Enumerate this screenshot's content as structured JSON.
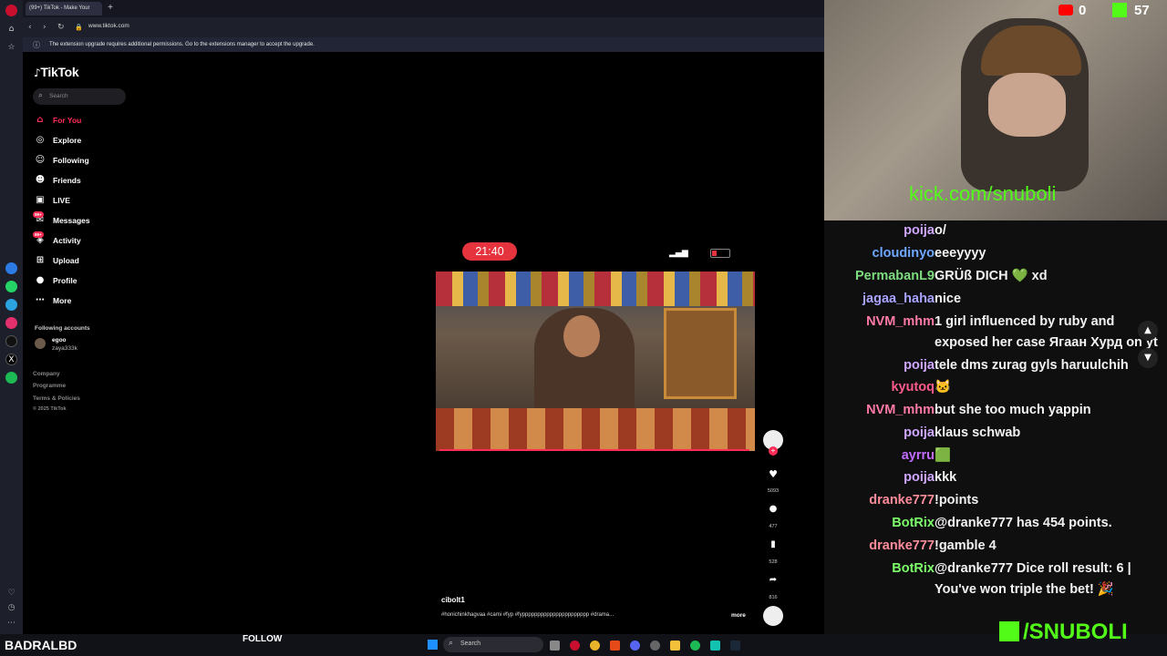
{
  "browser": {
    "tab_title": "(99+) TikTok - Make Your",
    "new_tab": "+",
    "url": "www.tiktok.com",
    "notice": "The extension upgrade requires additional permissions. Go to the extensions manager to accept the upgrade."
  },
  "tiktok": {
    "logo": "TikTok",
    "search_placeholder": "Search",
    "nav": [
      {
        "label": "For You",
        "icon": "home-icon"
      },
      {
        "label": "Explore",
        "icon": "compass-icon"
      },
      {
        "label": "Following",
        "icon": "user-follow-icon"
      },
      {
        "label": "Friends",
        "icon": "friends-icon"
      },
      {
        "label": "LIVE",
        "icon": "live-icon"
      },
      {
        "label": "Messages",
        "icon": "messages-icon",
        "badge": "99+"
      },
      {
        "label": "Activity",
        "icon": "activity-icon",
        "badge": "99+"
      },
      {
        "label": "Upload",
        "icon": "upload-icon"
      },
      {
        "label": "Profile",
        "icon": "profile-icon"
      },
      {
        "label": "More",
        "icon": "more-icon"
      }
    ],
    "following_header": "Following accounts",
    "following_account": {
      "name": "egoo",
      "handle": "zaya333k"
    },
    "footer": [
      "Company",
      "Programme",
      "Terms & Policies",
      "© 2025 TikTok"
    ],
    "video": {
      "time": "21:40",
      "author": "cibolt1",
      "caption": "#honichinkhagvaa #cami #fyp #fypppppppppppppppppppppp #drama...",
      "more": "more",
      "likes": "5093",
      "comments": "477",
      "saves": "528",
      "shares": "816"
    }
  },
  "stream": {
    "youtube_count": "0",
    "kick_count": "57",
    "webcam_overlay": "kick.com/snuboli",
    "bottom_left": "BADRALBD",
    "follow": "FOLLOW",
    "brand": "/SNUBOLI",
    "brand_color": "#53fc18"
  },
  "chat": [
    {
      "user": "poija",
      "color": "#d0a7ff",
      "text": "o/"
    },
    {
      "user": "cloudinyo",
      "color": "#6fa8ff",
      "text": "eeeyyyy"
    },
    {
      "user": "PermabanL9",
      "color": "#7ddc7f",
      "text": "GRÜß DICH 💚 xd"
    },
    {
      "user": "jagaa_haha",
      "color": "#a9a4ff",
      "text": "nice"
    },
    {
      "user": "NVM_mhm",
      "color": "#ff7aa8",
      "text": "1 girl influenced by ruby and exposed her case Ягаан Хурд on yt"
    },
    {
      "user": "poija",
      "color": "#d0a7ff",
      "text": "tele dms zurag gyls haruulchih"
    },
    {
      "user": "kyutoq",
      "color": "#ff5a8c",
      "text": "🐱"
    },
    {
      "user": "NVM_mhm",
      "color": "#ff7aa8",
      "text": "but she too much yappin"
    },
    {
      "user": "poija",
      "color": "#d0a7ff",
      "text": "klaus schwab"
    },
    {
      "user": "ayrru",
      "color": "#c26bff",
      "text": "🟩"
    },
    {
      "user": "poija",
      "color": "#d0a7ff",
      "text": "kkk"
    },
    {
      "user": "dranke777",
      "color": "#ff8c9a",
      "text": "!points"
    },
    {
      "user": "BotRix",
      "color": "#7dff6a",
      "text": "@dranke777 has 454 points."
    },
    {
      "user": "dranke777",
      "color": "#ff8c9a",
      "text": "!gamble 4"
    },
    {
      "user": "BotRix",
      "color": "#7dff6a",
      "text": "@dranke777 Dice roll result: 6 | You've won triple the bet! 🎉"
    }
  ],
  "taskbar": {
    "search": "Search"
  }
}
